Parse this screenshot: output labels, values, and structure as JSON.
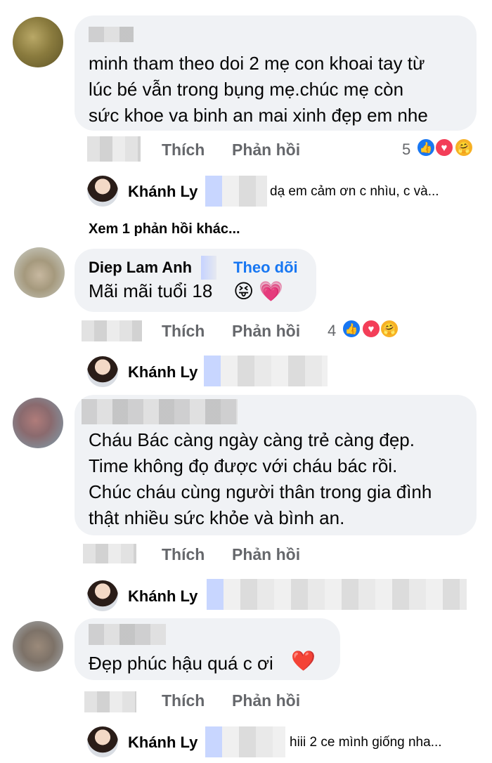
{
  "comments": [
    {
      "text_lines": [
        "minh tham theo doi 2 mẹ con khoai tay từ",
        "lúc bé vẫn trong bụng mẹ.chúc mẹ còn",
        "sức khoe va binh an mai xinh đẹp em nhe"
      ],
      "like_label": "Thích",
      "reply_label": "Phản hồi",
      "reaction_count": "5",
      "reply": {
        "name": "Khánh Ly",
        "text": "dạ em cảm ơn c nhìu, c và..."
      },
      "more_replies": "Xem 1 phản hồi khác..."
    },
    {
      "author": "Diep Lam Anh",
      "follow_label": "Theo dõi",
      "text": "Mãi mãi tuổi 18",
      "emojis": [
        "😝",
        "💗"
      ],
      "like_label": "Thích",
      "reply_label": "Phản hồi",
      "reaction_count": "4",
      "reply": {
        "name": "Khánh Ly"
      }
    },
    {
      "text_lines": [
        "Cháu Bác càng ngày càng trẻ càng đẹp.",
        "Time không đọ được với cháu bác rồi.",
        "Chúc cháu cùng người thân trong gia đình",
        "thật nhiều sức khỏe và bình an."
      ],
      "like_label": "Thích",
      "reply_label": "Phản hồi",
      "reply": {
        "name": "Khánh Ly"
      }
    },
    {
      "text": "Đẹp phúc hậu quá c ơi",
      "emoji": "❤️",
      "like_label": "Thích",
      "reply_label": "Phản hồi",
      "reply": {
        "name": "Khánh Ly",
        "text": "hiii 2 ce mình giống nha..."
      }
    }
  ],
  "icons": {
    "like": "like-icon",
    "love": "love-icon",
    "care": "care-icon"
  },
  "colors": {
    "bubble": "#f0f2f5",
    "action": "#65676b",
    "link": "#1877f2",
    "love": "#f33e58",
    "care": "#f7b125"
  }
}
